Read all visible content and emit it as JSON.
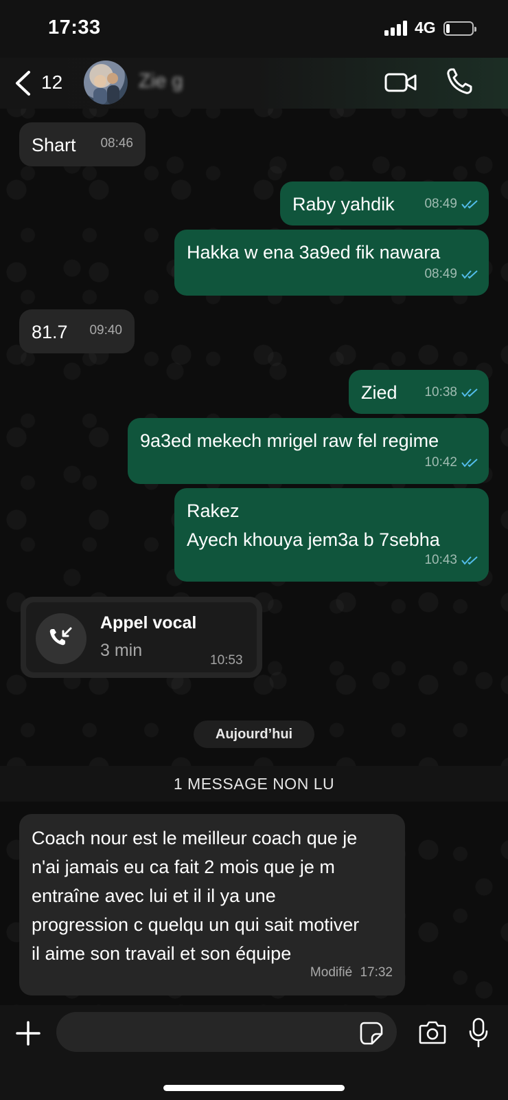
{
  "status_bar": {
    "time": "17:33",
    "network": "4G",
    "battery_level": 0.15
  },
  "header": {
    "back_count": "12",
    "contact_name": "Zie       g"
  },
  "messages": [
    {
      "dir": "in",
      "text": "Shart",
      "time": "08:46"
    },
    {
      "dir": "out",
      "text": "Raby yahdik",
      "time": "08:49",
      "status": "read"
    },
    {
      "dir": "out",
      "text": "Hakka w ena 3a9ed fik nawara",
      "time": "08:49",
      "status": "read"
    },
    {
      "dir": "in",
      "text": "81.7",
      "time": "09:40"
    },
    {
      "dir": "out",
      "text": "Zied",
      "time": "10:38",
      "status": "read"
    },
    {
      "dir": "out",
      "text": "9a3ed mekech mrigel raw fel regime",
      "time": "10:42",
      "status": "read"
    },
    {
      "dir": "out",
      "lines": [
        "Rakez",
        "Ayech khouya jem3a b 7sebha"
      ],
      "time": "10:43",
      "status": "read"
    }
  ],
  "call": {
    "title": "Appel vocal",
    "duration": "3 min",
    "time": "10:53"
  },
  "day_separator": "Aujourd’hui",
  "unread_banner": "1 MESSAGE NON LU",
  "last_message": {
    "lines": [
      "Coach  nour est le meilleur coach que je",
      "n'ai jamais eu ca fait 2 mois que je m",
      "entraîne avec lui et il il ya une",
      "progression c quelqu un qui sait motiver",
      "il aime son travail et son équipe"
    ],
    "edited_label": "Modifié",
    "time": "17:32"
  },
  "composer": {
    "placeholder": ""
  },
  "colors": {
    "outgoing": "#10553c",
    "incoming": "#262626",
    "read_ticks": "#53bdeb"
  }
}
